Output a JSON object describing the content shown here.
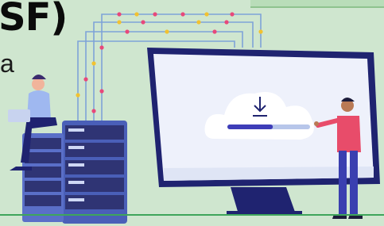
{
  "title_fragment": "SF)",
  "subtitle_fragment": "a",
  "colors": {
    "background": "#cfe6cf",
    "monitor_frame": "#1f2370",
    "monitor_screen": "#eef1fb",
    "cloud": "#ffffff",
    "progress_fill": "#3e3db8",
    "progress_track": "#b7c6ea",
    "server_body": "#3a3f8f",
    "wire_pink": "#e8487a",
    "wire_yellow": "#f2c230",
    "person_shirt": "#e84c6a",
    "woman_shirt": "#9fb8f0"
  },
  "download": {
    "icon": "download-arrow-icon",
    "progress_fraction": 0.55
  }
}
